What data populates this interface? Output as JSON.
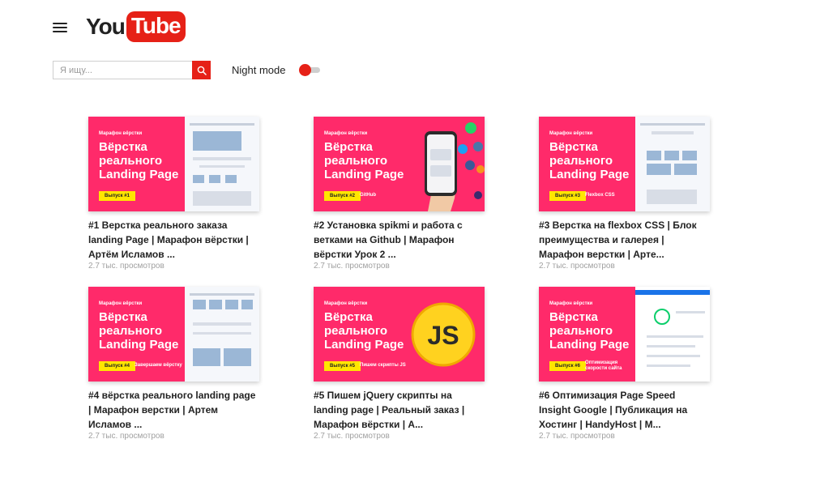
{
  "header": {
    "logo_you": "You",
    "logo_tube": "Tube",
    "menu_icon": "hamburger-menu-icon"
  },
  "search": {
    "placeholder": "Я ищу...",
    "value": "",
    "button_icon": "search-icon"
  },
  "night_mode": {
    "label": "Night mode",
    "enabled": false
  },
  "colors": {
    "accent": "#e62117",
    "thumb_bg": "#ff2a6a",
    "badge": "#ffe600"
  },
  "videos": [
    {
      "title": "#1 Верстка реального заказа landing Page | Марафон вёрстки | Артём Исламов ...",
      "views": "2.7 тыс. просмотров",
      "thumb": {
        "small": "Марафон вёрстки",
        "line1": "Вёрстка",
        "line2": "реального",
        "line3": "Landing Page",
        "badge": "Выпуск #1",
        "extra": ""
      }
    },
    {
      "title": "#2 Установка spikmi и работа с ветками на Github | Марафон вёрстки Урок 2 ...",
      "views": "2.7 тыс. просмотров",
      "thumb": {
        "small": "Марафон вёрстки",
        "line1": "Вёрстка",
        "line2": "реального",
        "line3": "Landing Page",
        "badge": "Выпуск #2",
        "extra": "GitHub"
      }
    },
    {
      "title": "#3 Верстка на flexbox CSS | Блок преимущества и галерея | Марафон верстки | Арте...",
      "views": "2.7 тыс. просмотров",
      "thumb": {
        "small": "Марафон вёрстки",
        "line1": "Вёрстка",
        "line2": "реального",
        "line3": "Landing Page",
        "badge": "Выпуск #3",
        "extra": "Flexbox CSS"
      }
    },
    {
      "title": "#4 вёрстка реального landing page | Марафон верстки | Артем Исламов ...",
      "views": "2.7 тыс. просмотров",
      "thumb": {
        "small": "Марафон вёрстки",
        "line1": "Вёрстка",
        "line2": "реального",
        "line3": "Landing Page",
        "badge": "Выпуск #4",
        "extra": "Завершаем вёрстку"
      }
    },
    {
      "title": "#5 Пишем jQuery скрипты на landing page | Реальный заказ | Марафон вёрстки | А...",
      "views": "2.7 тыс. просмотров",
      "thumb": {
        "small": "Марафон вёрстки",
        "line1": "Вёрстка",
        "line2": "реального",
        "line3": "Landing Page",
        "badge": "Выпуск #5",
        "extra": "Пишем скрипты JS"
      }
    },
    {
      "title": "#6 Оптимизация Page Speed Insight Google | Публикация на Хостинг | HandyHost | М...",
      "views": "2.7 тыс. просмотров",
      "thumb": {
        "small": "Марафон вёрстки",
        "line1": "Вёрстка",
        "line2": "реального",
        "line3": "Landing Page",
        "badge": "Выпуск #6",
        "extra": "Оптимизация скорости сайта"
      }
    }
  ]
}
